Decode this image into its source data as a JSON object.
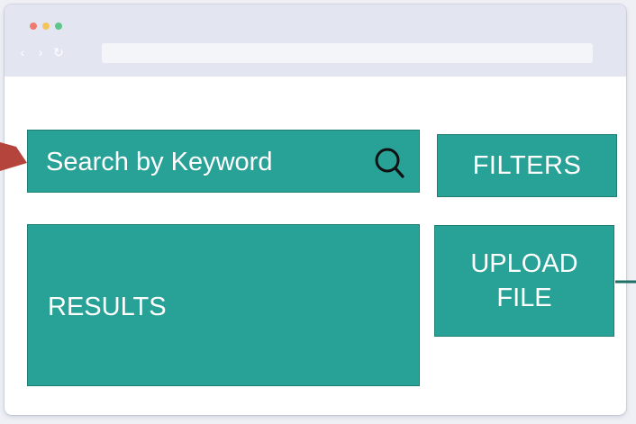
{
  "window": {
    "controls": [
      {
        "name": "close",
        "color": "#f17a6f"
      },
      {
        "name": "minimize",
        "color": "#f3c55c"
      },
      {
        "name": "maximize",
        "color": "#5ec68a"
      }
    ],
    "nav": {
      "back_glyph": "‹",
      "forward_glyph": "›",
      "reload_glyph": "↻"
    },
    "address_value": ""
  },
  "search": {
    "label": "Search by Keyword",
    "icon": "search-icon"
  },
  "filters": {
    "label": "FILTERS"
  },
  "results": {
    "label": "RESULTS"
  },
  "upload": {
    "label_line1": "UPLOAD",
    "label_line2": "FILE"
  },
  "colors": {
    "accent": "#28a197",
    "accent_border": "#1f7e73",
    "pointer_red": "#b5453c",
    "connector": "#1f6f66"
  }
}
